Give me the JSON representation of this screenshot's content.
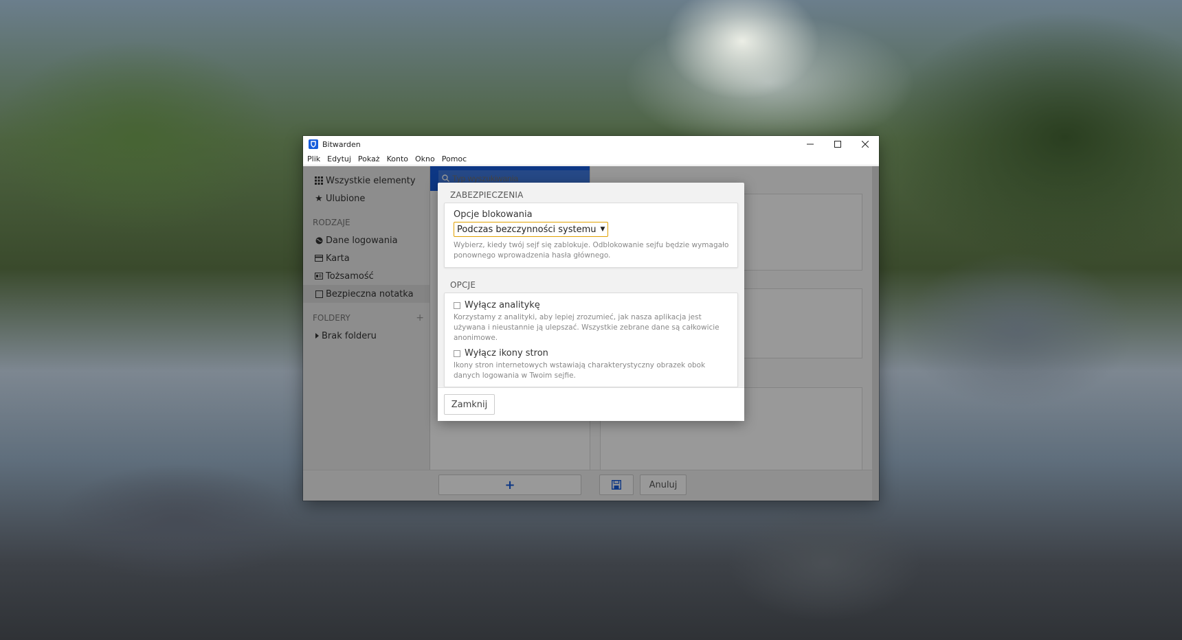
{
  "window": {
    "title": "Bitwarden",
    "controls": {
      "minimize": "—",
      "maximize": "☐",
      "close": "✕"
    }
  },
  "menubar": {
    "items": [
      "Plik",
      "Edytuj",
      "Pokaż",
      "Konto",
      "Okno",
      "Pomoc"
    ]
  },
  "sidebar": {
    "all_items": "Wszystkie elementy",
    "favorites": "Ulubione",
    "types_header": "RODZAJE",
    "types": [
      "Dane logowania",
      "Karta",
      "Tożsamość",
      "Bezpieczna notatka"
    ],
    "folders_header": "FOLDERY",
    "folders_add": "+",
    "no_folder": "Brak folderu"
  },
  "search": {
    "placeholder": "Typ wyszukiwania"
  },
  "footer": {
    "add_label": "+",
    "cancel_label": "Anuluj"
  },
  "modal": {
    "security_title": "ZABEZPIECZENIA",
    "lock_label": "Opcje blokowania",
    "lock_value": "Podczas bezczynności systemu",
    "lock_help": "Wybierz, kiedy twój sejf się zablokuje. Odblokowanie sejfu będzie wymagało ponownego wprowadzenia hasła głównego.",
    "options_title": "OPCJE",
    "analytics_label": "Wyłącz analitykę",
    "analytics_help": "Korzystamy z analityki, aby lepiej zrozumieć, jak nasza aplikacja jest używana i nieustannie ją ulepszać. Wszystkie zebrane dane są całkowicie anonimowe.",
    "icons_label": "Wyłącz ikony stron",
    "icons_help": "Ikony stron internetowych wstawiają charakterystyczny obrazek obok danych logowania w Twoim sejfie.",
    "close_label": "Zamknij"
  },
  "colors": {
    "brand": "#175ddc",
    "select_border": "#e0a000"
  }
}
